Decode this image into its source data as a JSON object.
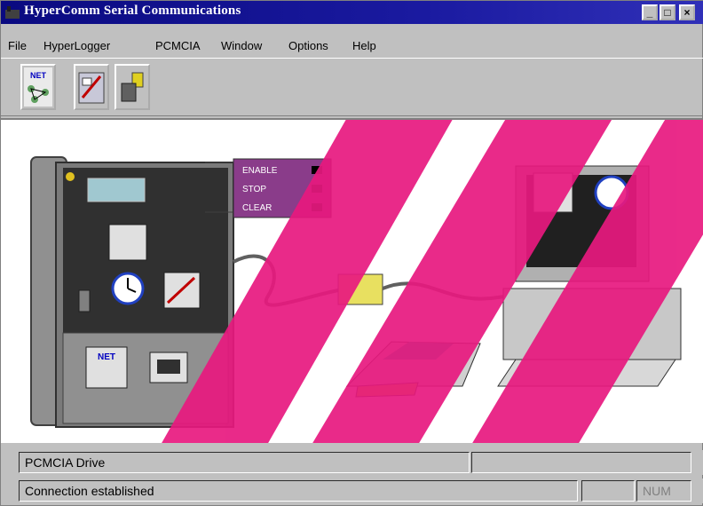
{
  "window": {
    "title": "HyperComm Serial Communications"
  },
  "menu": {
    "items": [
      "File",
      "HyperLogger",
      "PCMCIA",
      "Window",
      "Options",
      "Help"
    ]
  },
  "toolbar": {
    "buttons": [
      "NET",
      "",
      ""
    ]
  },
  "device": {
    "controls": [
      "ENABLE",
      "STOP",
      "CLEAR"
    ],
    "net_label": "NET"
  },
  "status": {
    "drive": "PCMCIA Drive",
    "connection": "Connection established",
    "num": "NUM"
  },
  "colors": {
    "titlebar": "#0a0a80",
    "accent_pink": "#e8197f",
    "panel_purple": "#8a3c8a"
  }
}
